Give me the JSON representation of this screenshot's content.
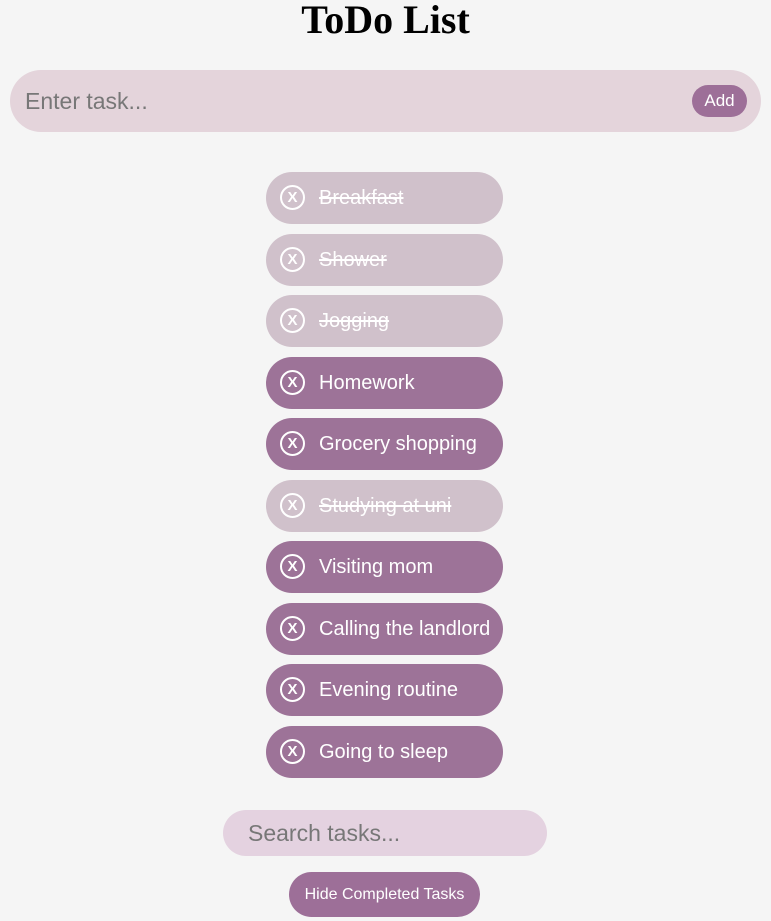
{
  "header": {
    "title": "ToDo List"
  },
  "add_task": {
    "placeholder": "Enter task...",
    "value": "",
    "button_label": "Add"
  },
  "tasks": [
    {
      "label": "Breakfast",
      "completed": true,
      "remove_icon": "X"
    },
    {
      "label": "Shower",
      "completed": true,
      "remove_icon": "X"
    },
    {
      "label": "Jogging",
      "completed": true,
      "remove_icon": "X"
    },
    {
      "label": "Homework",
      "completed": false,
      "remove_icon": "X"
    },
    {
      "label": "Grocery shopping",
      "completed": false,
      "remove_icon": "X"
    },
    {
      "label": "Studying at uni",
      "completed": true,
      "remove_icon": "X"
    },
    {
      "label": "Visiting mom",
      "completed": false,
      "remove_icon": "X"
    },
    {
      "label": "Calling the landlord",
      "completed": false,
      "remove_icon": "X"
    },
    {
      "label": "Evening routine",
      "completed": false,
      "remove_icon": "X"
    },
    {
      "label": "Going to sleep",
      "completed": false,
      "remove_icon": "X"
    }
  ],
  "search": {
    "placeholder": "Search tasks...",
    "value": ""
  },
  "footer": {
    "hide_completed_label": "Hide Completed Tasks"
  },
  "colors": {
    "background": "#f5f5f5",
    "accent": "#9d6f98",
    "task_active": "#9d7398",
    "task_completed": "#d0c1cb",
    "input_background": "#e4d4db",
    "search_background": "#e4d2e0"
  },
  "icons": {
    "remove": "close-icon"
  }
}
